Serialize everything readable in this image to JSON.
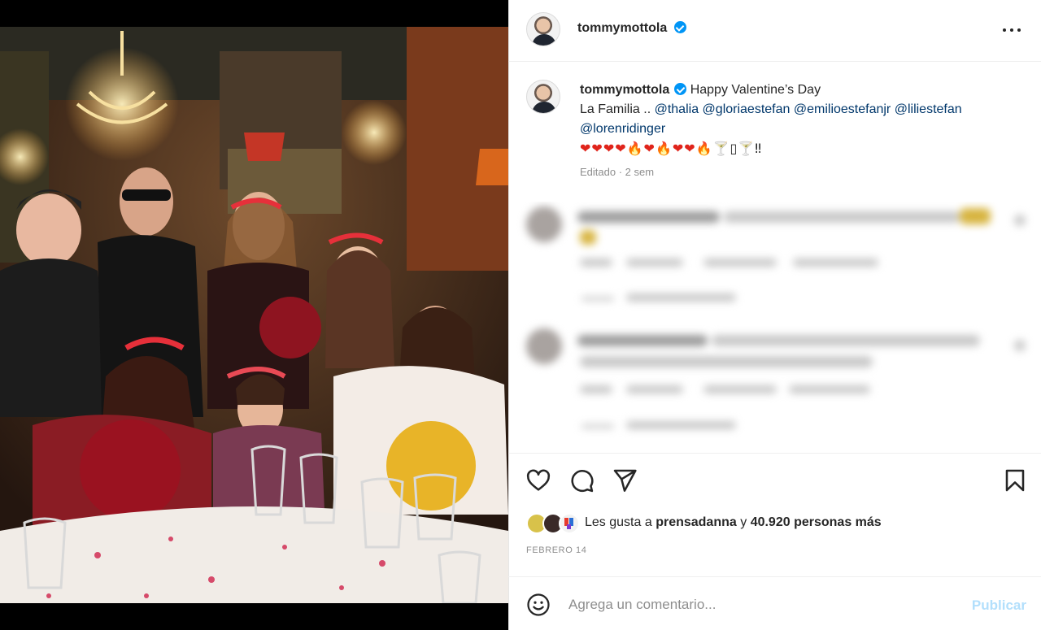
{
  "post": {
    "username": "tommymottola",
    "caption_user": "tommymottola",
    "caption_line1": "Happy Valentine’s Day",
    "caption_line2_prefix": "La Familia ..",
    "mentions": [
      "@thalia",
      "@gloriaestefan",
      "@emilioestefanjr",
      "@liliestefan",
      "@lorenridinger"
    ],
    "emoji_line": "❤❤❤❤🔥❤🔥❤🔥🍸🍸!!",
    "emoji_suffix": "‼",
    "edited_label": "Editado",
    "edited_time": "2 sem",
    "likes_prefix": "Les gusta a",
    "likes_user": "prensadanna",
    "likes_conjunction": "y",
    "likes_count": "40.920 personas más",
    "date": "FEBRERO 14",
    "comment_placeholder": "Agrega un comentario...",
    "publish_label": "Publicar"
  },
  "icons": {
    "more": "more-options-icon",
    "like": "heart-outline-icon",
    "comment": "comment-bubble-icon",
    "share": "paper-plane-icon",
    "save": "bookmark-icon",
    "emoji": "smiley-icon",
    "verified": "verified-badge-icon"
  },
  "colors": {
    "link": "#00376b",
    "verified": "#0095f6",
    "publish_disabled": "#b2dffc",
    "meta": "#8e8e8e"
  }
}
